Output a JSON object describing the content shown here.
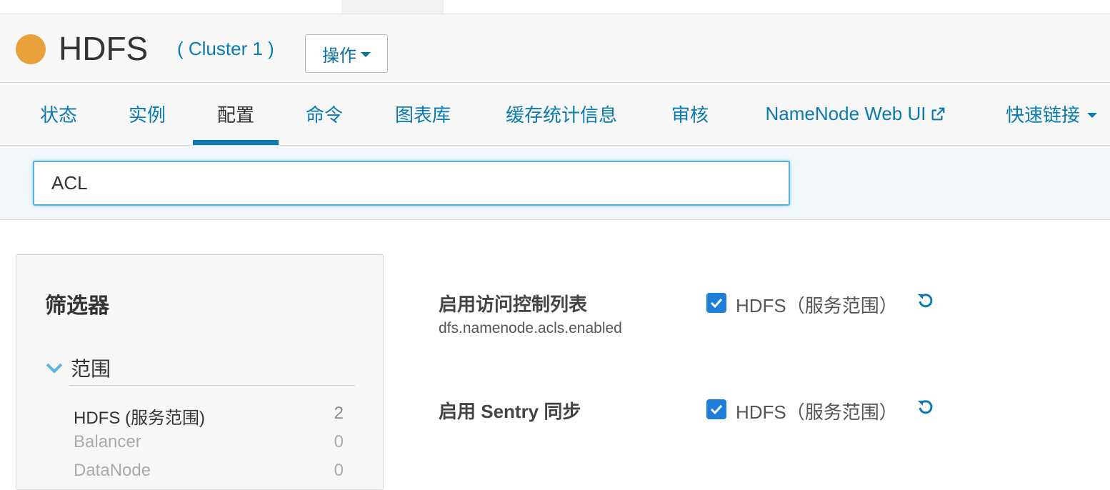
{
  "header": {
    "service_name": "HDFS",
    "cluster_link": "( Cluster 1 )",
    "actions_button": "操作",
    "status_color": "#e8a03a"
  },
  "tabs": [
    {
      "label": "状态",
      "active": false
    },
    {
      "label": "实例",
      "active": false
    },
    {
      "label": "配置",
      "active": true
    },
    {
      "label": "命令",
      "active": false
    },
    {
      "label": "图表库",
      "active": false
    },
    {
      "label": "缓存统计信息",
      "active": false
    },
    {
      "label": "审核",
      "active": false
    },
    {
      "label": "NameNode Web UI",
      "active": false,
      "icon": "external-link-icon"
    },
    {
      "label": "快速链接",
      "active": false,
      "icon": "caret-down-icon"
    }
  ],
  "search": {
    "value": "ACL"
  },
  "filters": {
    "title": "筛选器",
    "scope_label": "范围",
    "items": [
      {
        "label": "HDFS (服务范围)",
        "count": "2",
        "enabled": true
      },
      {
        "label": "Balancer",
        "count": "0",
        "enabled": false
      },
      {
        "label": "DataNode",
        "count": "0",
        "enabled": false
      }
    ]
  },
  "properties": [
    {
      "display_name": "启用访问控制列表",
      "key": "dfs.namenode.acls.enabled",
      "scope": "HDFS（服务范围）",
      "checked": true
    },
    {
      "display_name": "启用 Sentry 同步",
      "key": "",
      "scope": "HDFS（服务范围）",
      "checked": true
    }
  ],
  "colors": {
    "accent": "#0a7bb0",
    "checkbox": "#1f7fd8",
    "search_border": "#53b3da"
  }
}
